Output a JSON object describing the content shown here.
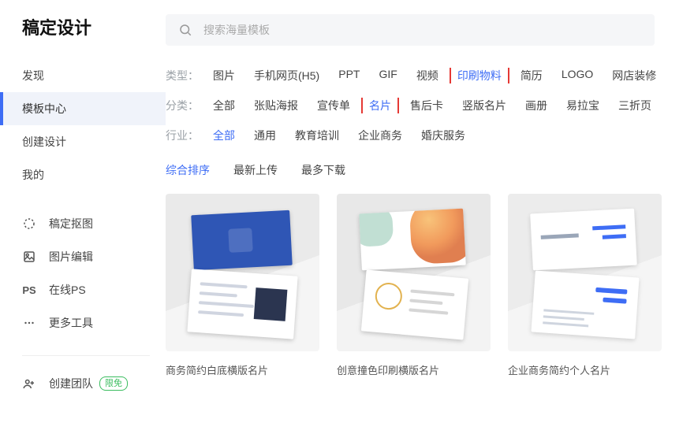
{
  "brand": "稿定设计",
  "search": {
    "placeholder": "搜索海量模板"
  },
  "sidebar": {
    "main": [
      {
        "label": "发现"
      },
      {
        "label": "模板中心"
      },
      {
        "label": "创建设计"
      },
      {
        "label": "我的"
      }
    ],
    "tools": [
      {
        "label": "稿定抠图",
        "icon": "dotted-circle-icon"
      },
      {
        "label": "图片编辑",
        "icon": "photo-icon"
      },
      {
        "label": "在线PS",
        "icon": "ps-icon"
      },
      {
        "label": "更多工具",
        "icon": "more-icon"
      }
    ],
    "team": {
      "label": "创建团队",
      "badge": "限免"
    }
  },
  "filters": {
    "type": {
      "label": "类型：",
      "opts": [
        "图片",
        "手机网页(H5)",
        "PPT",
        "GIF",
        "视频",
        "印刷物料",
        "简历",
        "LOGO",
        "网店装修"
      ],
      "active": "印刷物料"
    },
    "cat": {
      "label": "分类：",
      "opts": [
        "全部",
        "张贴海报",
        "宣传单",
        "名片",
        "售后卡",
        "竖版名片",
        "画册",
        "易拉宝",
        "三折页"
      ],
      "active": "名片"
    },
    "ind": {
      "label": "行业：",
      "opts": [
        "全部",
        "通用",
        "教育培训",
        "企业商务",
        "婚庆服务"
      ],
      "active": "全部"
    }
  },
  "sort": {
    "opts": [
      "综合排序",
      "最新上传",
      "最多下载"
    ],
    "active": "综合排序"
  },
  "cards": [
    {
      "title": "商务简约白底横版名片"
    },
    {
      "title": "创意撞色印刷横版名片"
    },
    {
      "title": "企业商务简约个人名片"
    }
  ]
}
